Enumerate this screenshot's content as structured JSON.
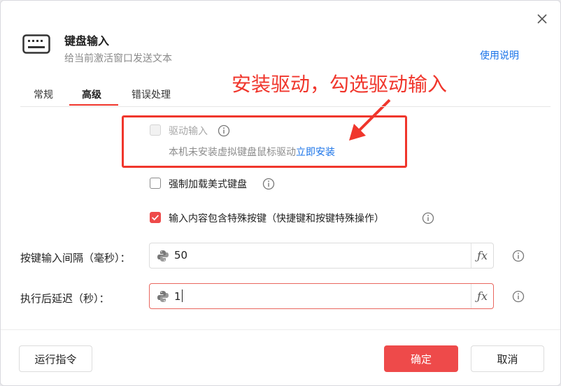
{
  "dialog": {
    "title": "键盘输入",
    "subtitle": "给当前激活窗口发送文本",
    "help_link": "使用说明",
    "close_icon": "close-icon"
  },
  "annotation": {
    "text": "安装驱动，勾选驱动输入",
    "color": "#f0362c"
  },
  "tabs": [
    {
      "label": "常规",
      "active": false
    },
    {
      "label": "高级",
      "active": true
    },
    {
      "label": "错误处理",
      "active": false
    }
  ],
  "options": {
    "driver_input": {
      "label": "驱动输入",
      "checked": false,
      "disabled": true
    },
    "driver_hint": {
      "text": "本机未安装虚拟键盘鼠标驱动",
      "link": "立即安装"
    },
    "force_us_keyboard": {
      "label": "强制加载美式键盘",
      "checked": false
    },
    "special_keys": {
      "label": "输入内容包含特殊按键（快捷键和按键特殊操作）",
      "checked": true
    }
  },
  "fields": {
    "key_interval": {
      "label": "按键输入间隔（毫秒）：",
      "value": "50",
      "fx_label": "ƒx"
    },
    "delay_after": {
      "label": "执行后延迟（秒）：",
      "value": "1",
      "fx_label": "ƒx"
    }
  },
  "footer": {
    "run_button": "运行指令",
    "ok_button": "确定",
    "cancel_button": "取消"
  },
  "colors": {
    "accent": "#ee4a4a",
    "link": "#1a73e8"
  }
}
